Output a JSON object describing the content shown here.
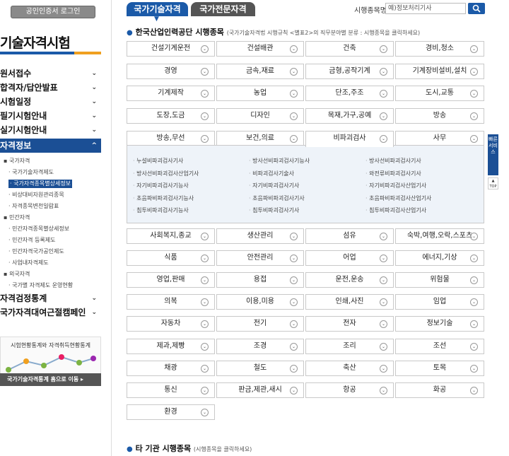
{
  "sidebar": {
    "cert_login": "공인인증서 로그인",
    "title": "기술자격시험",
    "menu": [
      {
        "label": "원서접수",
        "chevron": "⌄"
      },
      {
        "label": "합격자/답안발표",
        "chevron": "⌄"
      },
      {
        "label": "시험일정",
        "chevron": "⌄"
      },
      {
        "label": "필기시험안내",
        "chevron": "⌄"
      },
      {
        "label": "실기시험안내",
        "chevron": "⌄"
      },
      {
        "label": "자격정보",
        "chevron": "^"
      }
    ],
    "submenu": [
      {
        "label": "국가자격",
        "level": 1
      },
      {
        "label": "국가기술자격제도",
        "level": 2
      },
      {
        "label": "국가자격종목별상세정보",
        "level": 2,
        "selected": true
      },
      {
        "label": "비상대비자원관리종목",
        "level": 2
      },
      {
        "label": "자격종목변천일람표",
        "level": 2
      },
      {
        "label": "민간자격",
        "level": 1
      },
      {
        "label": "민간자격종목별상세정보",
        "level": 2
      },
      {
        "label": "민간자격 등록제도",
        "level": 2
      },
      {
        "label": "민간자격국가공인제도",
        "level": 2
      },
      {
        "label": "사업내자격제도",
        "level": 2
      },
      {
        "label": "외국자격",
        "level": 1
      },
      {
        "label": "국가별 자격제도 운영현황",
        "level": 2
      }
    ],
    "bottom_menu": [
      {
        "label": "자격검정통계",
        "chevron": "⌄"
      },
      {
        "label": "국가자격대여근절캠페인",
        "chevron": "⌄"
      }
    ],
    "stats_title": "시험현황통계와 자격취득현황통계",
    "stats_button": "국가기술자격통계 홈으로 이동"
  },
  "tabs": [
    "국가기술자격",
    "국가전문자격"
  ],
  "search": {
    "label": "시행종목명",
    "placeholder": "예)정보처리기사"
  },
  "section1": {
    "title": "한국산업인력공단 시행종목",
    "note": "(국가기술자격법 시행규칙 <별표2>의 직무분야별 분류 : 시행종목을 클릭하세요)"
  },
  "grid_top": [
    [
      "건설기계운전",
      "건설배관",
      "건축",
      "경비,청소"
    ],
    [
      "경영",
      "금속,재료",
      "금형,공작기계",
      "기계장비설비,설치"
    ],
    [
      "기계제작",
      "농업",
      "단조,주조",
      "도시,교통"
    ],
    [
      "도장,도금",
      "디자인",
      "목재,가구,공예",
      "방송"
    ],
    [
      "방송,무선",
      "보건,의료",
      "비파괴검사",
      "사무"
    ]
  ],
  "active_cell": "비파괴검사",
  "panel_items": [
    [
      "누설비파괴검사기사",
      "방사선비파괴검사기능사",
      "방사선비파괴검사기사"
    ],
    [
      "방사선비파괴검사산업기사",
      "비파괴검사기술사",
      "와전류비파괴검사기사"
    ],
    [
      "자기비파괴검사기능사",
      "자기비파괴검사기사",
      "자기비파괴검사산업기사"
    ],
    [
      "초음파비파괴검사기능사",
      "초음파비파괴검사기사",
      "초음파비파괴검사산업기사"
    ],
    [
      "침투비파괴검사기능사",
      "침투비파괴검사기사",
      "침투비파괴검사산업기사"
    ]
  ],
  "grid_bottom": [
    [
      "사회복지,종교",
      "생산관리",
      "섬유",
      "숙박,여행,오락,스포츠"
    ],
    [
      "식품",
      "안전관리",
      "어업",
      "에너지,기상"
    ],
    [
      "영업,판매",
      "용접",
      "운전,운송",
      "위험물"
    ],
    [
      "의복",
      "이용,미용",
      "인쇄,사진",
      "임업"
    ],
    [
      "자동차",
      "전기",
      "전자",
      "정보기술"
    ],
    [
      "제과,제빵",
      "조경",
      "조리",
      "조선"
    ],
    [
      "채광",
      "철도",
      "축산",
      "토목"
    ],
    [
      "통신",
      "판금,제관,새시",
      "항공",
      "화공"
    ],
    [
      "환경"
    ]
  ],
  "section2": {
    "title": "타 기관 시행종목",
    "note": "(시행종목을 클릭하세요)"
  },
  "widget": {
    "label": "빠른서비스",
    "top": "TOP"
  }
}
